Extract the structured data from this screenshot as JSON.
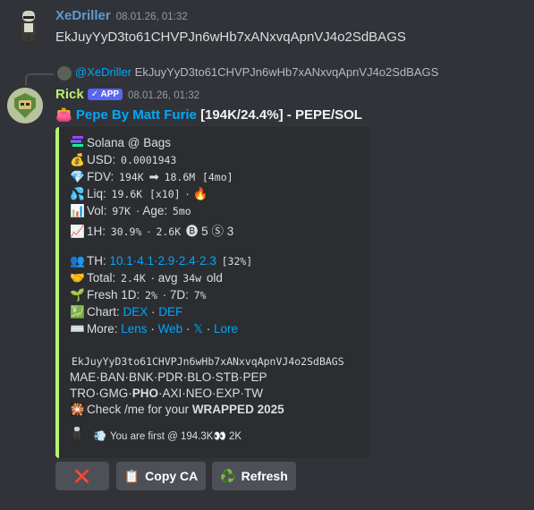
{
  "msg1": {
    "username": "XeDriller",
    "timestamp": "08.01.26, 01:32",
    "text": "EkJuyYyD3to61CHVPJn6wHb7xANxvqApnVJ4o2SdBAGS"
  },
  "reply": {
    "mention": "@XeDriller",
    "text": "EkJuyYyD3to61CHVPJn6wHb7xANxvqApnVJ4o2SdBAGS"
  },
  "msg2": {
    "username": "Rick",
    "badge": "✓ APP",
    "timestamp": "08.01.26, 01:32",
    "title_emoji": "👛",
    "title_link": "Pepe By Matt Furie",
    "title_rest": "[194K/24.4%] - PEPE/SOL"
  },
  "embed": {
    "chain": "Solana @ Bags",
    "usd_label": "USD:",
    "usd_value": "0.0001943",
    "fdv_label": "FDV:",
    "fdv_from": "194K",
    "fdv_arrow": "➡",
    "fdv_to": "18.6M",
    "fdv_age": "[4mo]",
    "liq_label": "Liq:",
    "liq_value": "19.6K",
    "liq_mult": "[x10]",
    "liq_sep": "·",
    "liq_fire": "🔥",
    "vol_label": "Vol:",
    "vol_value": "97K",
    "age_label": "· Age:",
    "age_value": "5mo",
    "h1_label": "1H:",
    "h1_value": "30.9%",
    "h1_sep": "·",
    "h1_trades": "2.6K",
    "h1_buy_icon": "🅑",
    "h1_buy": "5",
    "h1_sell_icon": "Ⓢ",
    "h1_sell": "3",
    "th_label": "TH:",
    "th_values": "10.1·4.1·2.9·2.4·2.3",
    "th_total": "[32%]",
    "total_label": "Total:",
    "total_value": "2.4K",
    "avg_label": "· avg",
    "avg_value": "34w",
    "avg_suffix": "old",
    "fresh_label": "Fresh 1D:",
    "fresh_1d": "2%",
    "fresh_7d_label": "· 7D:",
    "fresh_7d": "7%",
    "chart_label": "Chart:",
    "chart_links": [
      "DEX",
      "DEF"
    ],
    "more_label": "More:",
    "more_links": [
      "Lens",
      "Web",
      "𝕏",
      "Lore"
    ],
    "ca": "EkJuyYyD3to61CHVPJn6wHb7xANxvqApnVJ4o2SdBAGS",
    "tickers_1": "MAE·BAN·BNK·PDR·BLO·STB·PEP",
    "tickers_2_a": "TRO·GMG·",
    "tickers_2_b": "PHO",
    "tickers_2_c": "·AXI·NEO·EXP·TW",
    "check_text": "Check /me for your",
    "check_bold": "WRAPPED 2025",
    "first_text": "You are first @ 194.3K",
    "first_count": "2K"
  },
  "buttons": {
    "close_label": "❌",
    "copy_icon": "📋",
    "copy_label": "Copy CA",
    "refresh_icon": "♻️",
    "refresh_label": "Refresh"
  },
  "colors": {
    "background": "#313338",
    "username_blue": "#5b9bd5",
    "username_green": "#b9f26f",
    "embed_accent": "#b9f26f",
    "link": "#00a8fc"
  }
}
